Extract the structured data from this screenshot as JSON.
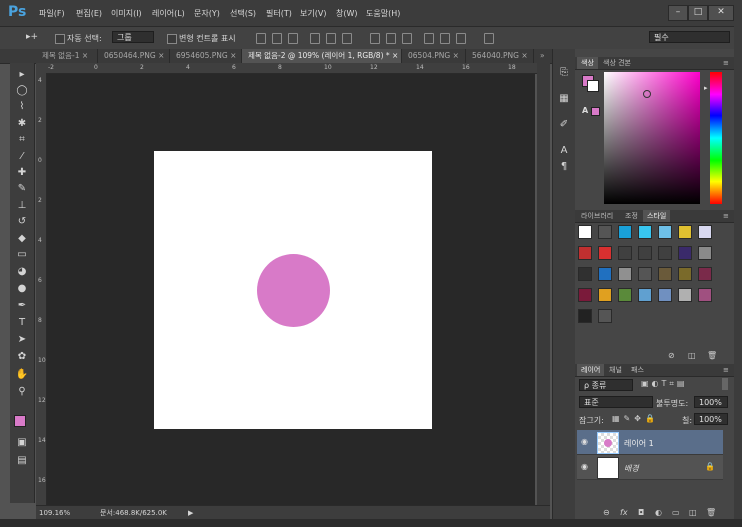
{
  "app": {
    "logo": "Ps",
    "menu": [
      "파일(F)",
      "편집(E)",
      "이미지(I)",
      "레이어(L)",
      "문자(Y)",
      "선택(S)",
      "필터(T)",
      "보기(V)",
      "창(W)",
      "도움말(H)"
    ],
    "window_controls": [
      "–",
      "□",
      "✕"
    ]
  },
  "options": {
    "move_tool_glyph": "▸+",
    "auto_select_label": "자동 선택:",
    "auto_select_value": "그룹",
    "transform_controls_label": "변형 컨트롤 표시",
    "workspace_value": "필수"
  },
  "tabs": [
    {
      "label": "제목 없음-1",
      "close": "×",
      "active": false
    },
    {
      "label": "0650464.PNG",
      "close": "×",
      "active": false
    },
    {
      "label": "6954605.PNG",
      "close": "×",
      "active": false
    },
    {
      "label": "제목 없음-2 @ 109% (레이어 1, RGB/8) *",
      "close": "×",
      "active": true
    },
    {
      "label": "06504.PNG",
      "close": "×",
      "active": false
    },
    {
      "label": "564040.PNG",
      "close": "×",
      "active": false
    }
  ],
  "tab_overflow": "»",
  "toolbar": [
    {
      "name": "move-tool-icon",
      "glyph": "▸"
    },
    {
      "name": "ellipse-marquee-icon",
      "glyph": "◯"
    },
    {
      "name": "lasso-icon",
      "glyph": "⌇"
    },
    {
      "name": "magic-wand-icon",
      "glyph": "✱"
    },
    {
      "name": "crop-icon",
      "glyph": "⌗"
    },
    {
      "name": "eyedropper-icon",
      "glyph": "⁄"
    },
    {
      "name": "healing-brush-icon",
      "glyph": "✚"
    },
    {
      "name": "brush-icon",
      "glyph": "✎"
    },
    {
      "name": "stamp-icon",
      "glyph": "⊥"
    },
    {
      "name": "history-brush-icon",
      "glyph": "↺"
    },
    {
      "name": "eraser-icon",
      "glyph": "◆"
    },
    {
      "name": "gradient-icon",
      "glyph": "▭"
    },
    {
      "name": "blur-icon",
      "glyph": "◕"
    },
    {
      "name": "dodge-icon",
      "glyph": "●"
    },
    {
      "name": "pen-icon",
      "glyph": "✒"
    },
    {
      "name": "type-icon",
      "glyph": "T"
    },
    {
      "name": "path-select-icon",
      "glyph": "➤"
    },
    {
      "name": "shape-icon",
      "glyph": "✿"
    },
    {
      "name": "hand-icon",
      "glyph": "✋"
    },
    {
      "name": "zoom-icon",
      "glyph": "⚲"
    }
  ],
  "rulers": {
    "h": [
      "-2",
      "0",
      "2",
      "4",
      "6",
      "8",
      "10",
      "12",
      "14",
      "16",
      "18"
    ],
    "v": [
      "4",
      "2",
      "0",
      "2",
      "4",
      "6",
      "8",
      "10",
      "12",
      "14",
      "16"
    ]
  },
  "canvas": {
    "circle_color": "#d87ac8",
    "foreground_color": "#d87ac8",
    "background_color": "#ffffff"
  },
  "status": {
    "zoom": "109.16%",
    "doc_info": "문서:468.8K/625.0K",
    "arrow": "▶"
  },
  "color_panel": {
    "tabs": [
      "색상",
      "색상 견본"
    ],
    "active_tab": 0,
    "hue_color": "#ff00cc",
    "menu_glyph": "≡"
  },
  "styles_panel": {
    "tabs": [
      "라이브러리",
      "조정",
      "스타일"
    ],
    "active_tab": 2,
    "swatches": [
      "#ffffff",
      "#555555",
      "#19a0d8",
      "#38c6f0",
      "#6ec0e8",
      "#e0c030",
      "#d8d8f0",
      "#c03030",
      "#d83030",
      "#404040",
      "#404040",
      "#404040",
      "#3a2a6a",
      "#8a8a8a",
      "#303030",
      "#2070c0",
      "#909090",
      "#555555",
      "#6a5a3a",
      "#7a6a2a",
      "#7a2a4a",
      "#7a1a3a",
      "#e0a020",
      "#5a8a3a",
      "#60a0d0",
      "#7090c0",
      "#b0b0b0",
      "#a05080",
      "#222222",
      "#555555"
    ]
  },
  "layers_panel": {
    "tabs": [
      "레이어",
      "채널",
      "패스"
    ],
    "active_tab": 0,
    "filter_label": "ρ 종류",
    "blend_mode": "표준",
    "opacity_label": "불투명도:",
    "opacity_value": "100%",
    "lock_label": "잠그기:",
    "fill_label": "칠:",
    "fill_value": "100%",
    "layers": [
      {
        "name": "레이어 1",
        "selected": true,
        "locked": false
      },
      {
        "name": "배경",
        "selected": false,
        "locked": true
      }
    ],
    "bottom_icons": [
      "⊖",
      "fx",
      "◘",
      "◐",
      "▭",
      "◫",
      "🗑"
    ]
  }
}
